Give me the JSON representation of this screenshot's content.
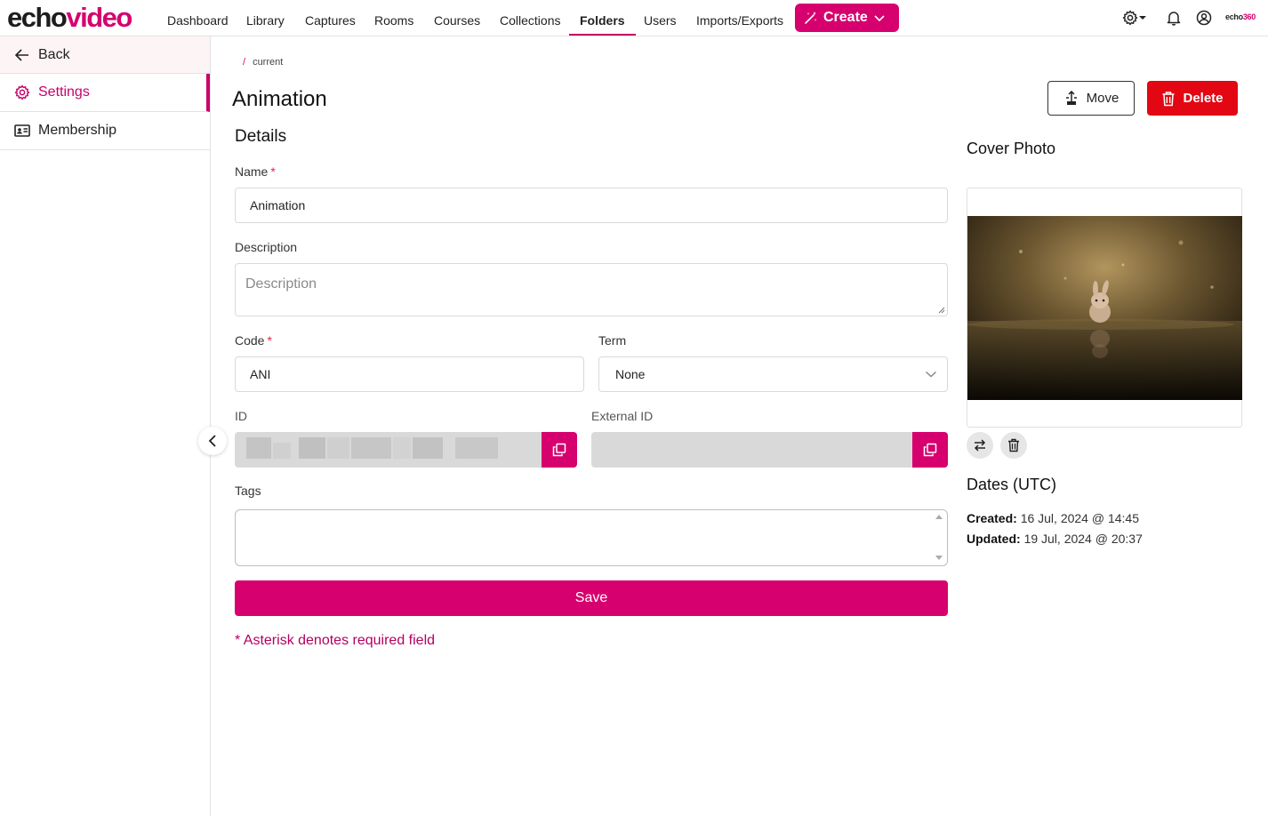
{
  "brand": {
    "part1": "echo",
    "part2": "video",
    "small_part1": "echo",
    "small_part2": "360"
  },
  "nav": {
    "items": [
      "Dashboard",
      "Library",
      "Captures",
      "Rooms",
      "Courses",
      "Collections",
      "Folders",
      "Users",
      "Imports/Exports"
    ],
    "active": "Folders",
    "create_label": "Create"
  },
  "sidebar": {
    "back_label": "Back",
    "settings_label": "Settings",
    "membership_label": "Membership"
  },
  "breadcrumb": {
    "separator": "/",
    "current": "current"
  },
  "page": {
    "title": "Animation",
    "move_label": "Move",
    "delete_label": "Delete"
  },
  "details": {
    "title": "Details",
    "name_label": "Name",
    "name_value": "Animation",
    "description_label": "Description",
    "description_placeholder": "Description",
    "code_label": "Code",
    "code_value": "ANI",
    "term_label": "Term",
    "term_value": "None",
    "id_label": "ID",
    "external_id_label": "External ID",
    "tags_label": "Tags",
    "save_label": "Save",
    "required_mark": "*",
    "required_note": "* Asterisk denotes required field"
  },
  "cover": {
    "title": "Cover Photo"
  },
  "dates": {
    "title": "Dates (UTC)",
    "created_label": "Created:",
    "created_value": "16 Jul, 2024 @ 14:45",
    "updated_label": "Updated:",
    "updated_value": "19 Jul, 2024 @ 20:37"
  },
  "colors": {
    "accent": "#d6006e",
    "danger": "#e30613"
  }
}
